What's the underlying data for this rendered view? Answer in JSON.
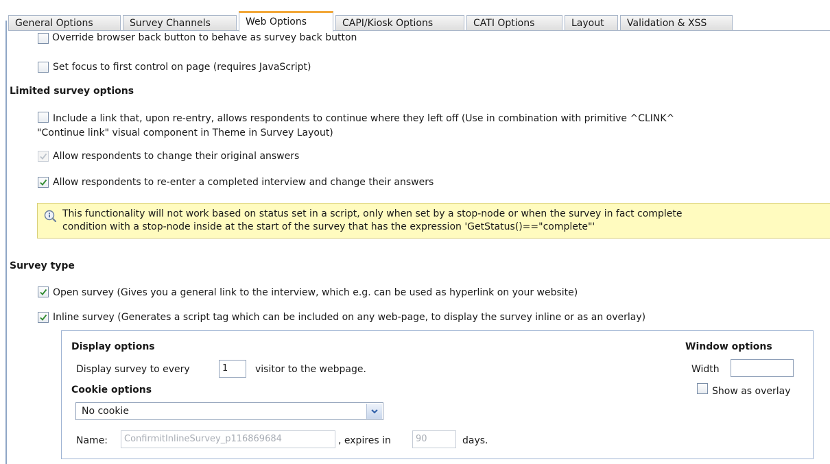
{
  "tabs": [
    {
      "label": "General Options"
    },
    {
      "label": "Survey Channels"
    },
    {
      "label": "Web Options"
    },
    {
      "label": "CAPI/Kiosk Options"
    },
    {
      "label": "CATI Options"
    },
    {
      "label": "Layout"
    },
    {
      "label": "Validation & XSS"
    }
  ],
  "active_tab": "Web Options",
  "options": {
    "override_back": {
      "label": "Override browser back button to behave as survey back button",
      "checked": false
    },
    "set_focus": {
      "label": "Set focus to first control on page (requires JavaScript)",
      "checked": false
    }
  },
  "limited": {
    "heading": "Limited survey options",
    "continue_link": {
      "label_line1": "Include a link that, upon re-entry, allows respondents to continue where they left off (Use in combination with primitive ^CLINK^",
      "label_line2": "\"Continue link\" visual component in Theme in Survey Layout)",
      "checked": false
    },
    "change_answers": {
      "label": "Allow respondents to change their original answers",
      "checked": true,
      "disabled": true
    },
    "reenter": {
      "label": "Allow respondents to re-enter a completed interview and change their answers",
      "checked": true
    },
    "notice_line1": "This functionality will not work based on status set in a script, only when set by a stop-node or when the survey in fact complete",
    "notice_line2": "condition with a stop-node inside at the start of the survey that has the expression 'GetStatus()==\"complete\"'"
  },
  "survey_type": {
    "heading": "Survey type",
    "open": {
      "label": "Open survey (Gives you a general link to the interview, which e.g. can be used as hyperlink on your website)",
      "checked": true
    },
    "inline": {
      "label": "Inline survey (Generates a script tag which can be included on any web-page, to display the survey inline or as an overlay)",
      "checked": true
    }
  },
  "display_options": {
    "heading": "Display options",
    "prefix": "Display survey to every",
    "every_value": "1",
    "suffix": "visitor to the webpage."
  },
  "cookie_options": {
    "heading": "Cookie options",
    "selected": "No cookie",
    "name_label": "Name:",
    "name_value": "ConfirmitInlineSurvey_p116869684",
    "expires_label": ", expires in",
    "expires_value": "90",
    "days_label": "days."
  },
  "window_options": {
    "heading": "Window options",
    "width_label": "Width",
    "width_value": "",
    "overlay_label": "Show as overlay",
    "overlay_checked": false
  }
}
